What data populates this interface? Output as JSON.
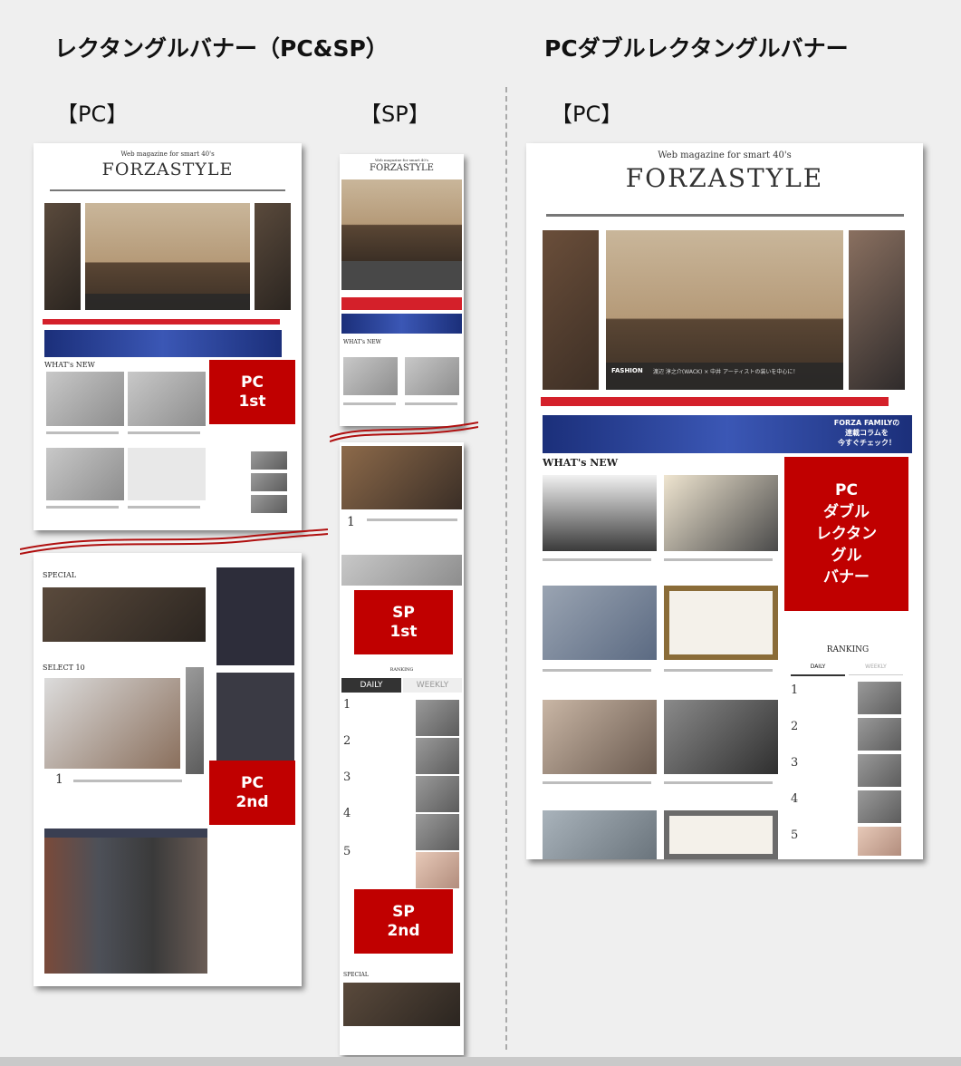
{
  "headings": {
    "left": "レクタングルバナー（PC&SP）",
    "right": "PCダブルレクタングルバナー"
  },
  "subheadings": {
    "pc_left": "【PC】",
    "sp": "【SP】",
    "pc_right": "【PC】"
  },
  "magazine": {
    "tagline": "Web magazine for smart 40's",
    "logo": "FORZASTYLE",
    "sp_logo": "FORZASTYLE",
    "whats_new": "WHAT's NEW",
    "special": "SPECIAL",
    "select": "SELECT 10",
    "ranking": "RANKING",
    "daily": "DAILY",
    "weekly": "WEEKLY",
    "banner_text": "FORZA FAMILYの\n連載コラムを\n今すぐチェック！",
    "hero_tag": "FASHION",
    "hero_caption": "渡辺 淳之介(WACK) × 中井 アーティストの装いを中心に！"
  },
  "ad_labels": {
    "pc_1st": "PC\n1st",
    "pc_2nd": "PC\n2nd",
    "sp_1st": "SP\n1st",
    "sp_2nd": "SP\n2nd",
    "pc_double": "PC\nダブル\nレクタン\nグル\nバナー"
  },
  "ranking_numbers": [
    "1",
    "2",
    "3",
    "4",
    "5"
  ],
  "colors": {
    "ad_red": "#c00000",
    "background": "#efefef",
    "divider": "#a9a9a9"
  }
}
